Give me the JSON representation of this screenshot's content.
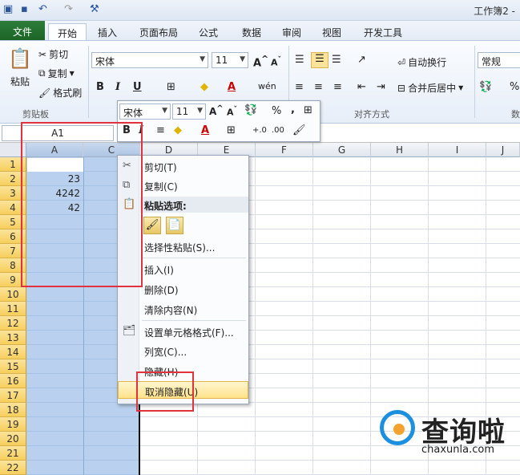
{
  "window": {
    "title": "工作簿2 -"
  },
  "quick_access": {
    "icons": [
      "excel-app-icon",
      "save-icon",
      "undo-icon",
      "redo-icon",
      "customize-icon"
    ]
  },
  "tabs": [
    {
      "label": "文件"
    },
    {
      "label": "开始"
    },
    {
      "label": "插入"
    },
    {
      "label": "页面布局"
    },
    {
      "label": "公式"
    },
    {
      "label": "数据"
    },
    {
      "label": "审阅"
    },
    {
      "label": "视图"
    },
    {
      "label": "开发工具"
    }
  ],
  "ribbon": {
    "clipboard": {
      "paste": "粘贴",
      "cut": "剪切",
      "copy": "复制",
      "format_painter": "格式刷",
      "group": "剪贴板"
    },
    "font": {
      "name": "宋体",
      "size": "11",
      "bold": "B",
      "italic": "I",
      "underline": "U",
      "grow": "A",
      "shrink": "A",
      "wen": "wén"
    },
    "alignment": {
      "wrap_text": "自动换行",
      "merge_center": "合并后居中",
      "group": "对齐方式"
    },
    "number": {
      "format": "常规",
      "percent": "%",
      "group": "数"
    }
  },
  "formula_bar": {
    "name_box": "A1"
  },
  "mini_toolbar": {
    "font": "宋体",
    "size": "11",
    "percent": "%",
    "comma": ",",
    "bold": "B",
    "italic": "I",
    "dec_inc": "+.0",
    "dec_dec": ".00"
  },
  "grid": {
    "columns": [
      "A",
      "C",
      "D",
      "E",
      "F",
      "G",
      "H",
      "I",
      "J"
    ],
    "rows": [
      "1",
      "2",
      "3",
      "4",
      "5",
      "6",
      "7",
      "8",
      "9",
      "10",
      "11",
      "12",
      "13",
      "14",
      "15",
      "16",
      "17",
      "18",
      "19",
      "20",
      "21",
      "22"
    ],
    "cells": [
      {
        "row": 2,
        "value": "23"
      },
      {
        "row": 3,
        "value": "4242"
      },
      {
        "row": 4,
        "value": "42"
      }
    ]
  },
  "context_menu": {
    "cut": "剪切(T)",
    "copy": "复制(C)",
    "paste_options_header": "粘贴选项:",
    "paste_special": "选择性粘贴(S)...",
    "insert": "插入(I)",
    "delete": "删除(D)",
    "clear_contents": "清除内容(N)",
    "format_cells": "设置单元格格式(F)...",
    "column_width": "列宽(C)...",
    "hide": "隐藏(H)",
    "unhide": "取消隐藏(U)"
  },
  "watermark": {
    "brand_cn": "查询啦",
    "brand_en": "chaxunla.com"
  },
  "colors": {
    "file_tab": "#1c6527",
    "selection": "#b9d1ee",
    "row_header": "#f6cf5d",
    "highlight": "#ffe28a",
    "red_box": "#e0333f",
    "accent": "#1c8fe0"
  }
}
